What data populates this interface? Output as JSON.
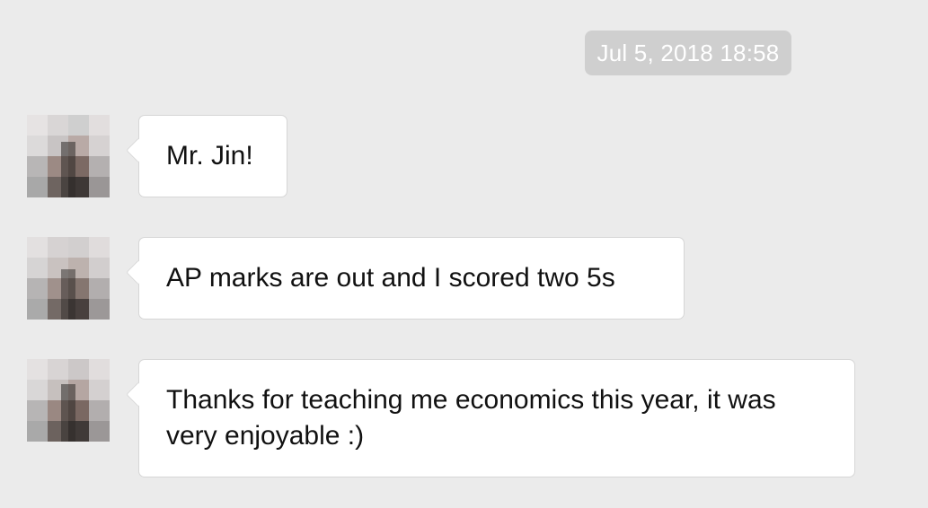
{
  "timestamp": "Jul 5, 2018 18:58",
  "messages": [
    {
      "sender": "incoming",
      "avatar": "pixelated-avatar",
      "text": "Mr. Jin!"
    },
    {
      "sender": "incoming",
      "avatar": "pixelated-avatar",
      "text": "AP marks are out and I scored two 5s"
    },
    {
      "sender": "incoming",
      "avatar": "pixelated-avatar",
      "text": "Thanks for teaching me economics this year, it was very enjoyable :)"
    }
  ],
  "colors": {
    "background": "#ebebeb",
    "timestamp_bg": "#cfcfcf",
    "timestamp_text": "#ffffff",
    "bubble_bg": "#ffffff",
    "bubble_border": "#d6d6d6",
    "message_text": "#111111"
  }
}
